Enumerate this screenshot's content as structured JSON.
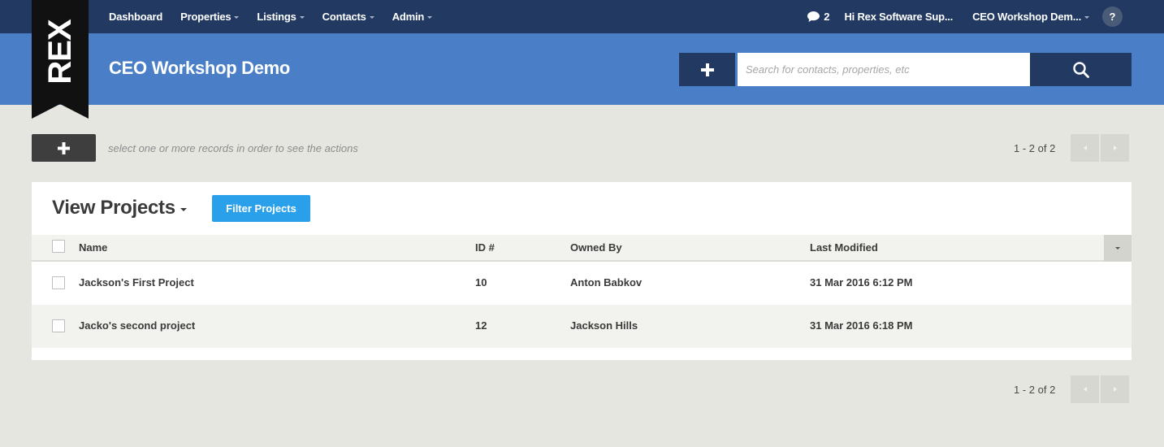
{
  "logo_text": "REX",
  "topnav": {
    "items": [
      {
        "label": "Dashboard",
        "has_caret": false
      },
      {
        "label": "Properties",
        "has_caret": true
      },
      {
        "label": "Listings",
        "has_caret": true
      },
      {
        "label": "Contacts",
        "has_caret": true
      },
      {
        "label": "Admin",
        "has_caret": true
      }
    ],
    "message_count": "2",
    "greeting": "Hi Rex Software Sup...",
    "account": "CEO Workshop Dem...",
    "help_label": "?"
  },
  "header": {
    "title": "CEO Workshop Demo",
    "search_placeholder": "Search for contacts, properties, etc",
    "search_value": ""
  },
  "toolbar": {
    "hint": "select one or more records in order to see the actions",
    "pager_count": "1 - 2 of 2"
  },
  "view": {
    "title": "View Projects",
    "filter_label": "Filter Projects"
  },
  "table": {
    "columns": {
      "name": "Name",
      "id": "ID #",
      "owner": "Owned By",
      "modified": "Last Modified"
    },
    "rows": [
      {
        "name": "Jackson's First Project",
        "id": "10",
        "owner": "Anton Babkov",
        "modified": "31 Mar 2016 6:12 PM"
      },
      {
        "name": "Jacko's second project",
        "id": "12",
        "owner": "Jackson Hills",
        "modified": "31 Mar 2016 6:18 PM"
      }
    ]
  },
  "footer": {
    "pager_count": "1 - 2 of 2"
  },
  "colors": {
    "nav_bg": "#223a62",
    "header_bg": "#4a7fc7",
    "accent_button": "#2aa0ea",
    "page_bg": "#e6e6e1"
  }
}
